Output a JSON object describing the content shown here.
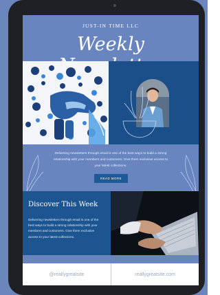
{
  "header": {
    "brand": "JUST-IN TIME LLC",
    "title": "Weekly Newsletter"
  },
  "intro": {
    "text": "Delivering newsletters through email is one of the best ways to build a strong relationship with your members and customers. Give them exclusive access to your latest collections.",
    "button_label": "READ MORE"
  },
  "discover": {
    "title": "Discover This Week",
    "text": "Delivering newsletters through email is one of the best ways to build a strong relationship with your members and customers. Give them exclusive access to your latest collections."
  },
  "footer": {
    "social": "@reallygreatsite",
    "website": "reallygreatsite.com"
  },
  "colors": {
    "background": "#6885c0",
    "navy": "#1c5590",
    "button": "#1d5a97",
    "device": "#1f2024"
  }
}
